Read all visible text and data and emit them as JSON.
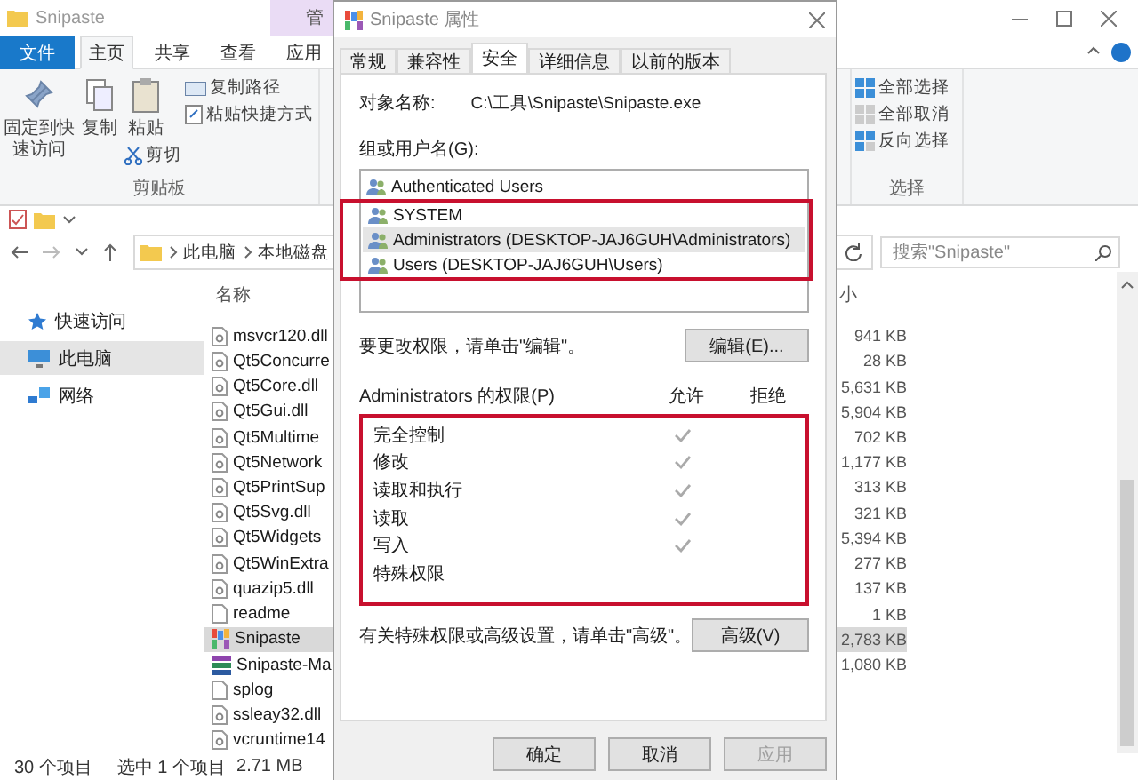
{
  "explorer": {
    "title": "Snipaste",
    "context_tab": "管",
    "ribbon_tabs": [
      {
        "label": "文件",
        "kind": "file",
        "selected": false
      },
      {
        "label": "主页",
        "kind": "tab",
        "selected": true
      },
      {
        "label": "共享",
        "kind": "tab",
        "selected": false
      },
      {
        "label": "查看",
        "kind": "tab",
        "selected": false
      },
      {
        "label": "应用",
        "kind": "tab",
        "selected": false
      }
    ],
    "clipboard": {
      "pin": "固定到快速访问",
      "copy": "复制",
      "paste": "粘贴",
      "copy_path": "复制路径",
      "paste_shortcut": "粘贴快捷方式",
      "cut": "剪切",
      "group": "剪贴板"
    },
    "select": {
      "items": [
        "全部选择",
        "全部取消",
        "反向选择"
      ],
      "group": "选择"
    },
    "address": {
      "crumbs": [
        "此电脑",
        "本地磁盘"
      ]
    },
    "search": {
      "placeholder": "搜索\"Snipaste\""
    },
    "nav": [
      {
        "label": "快速访问",
        "selected": false
      },
      {
        "label": "此电脑",
        "selected": true
      },
      {
        "label": "网络",
        "selected": false
      }
    ],
    "columns": {
      "name": "名称",
      "size": "小"
    },
    "files": [
      {
        "name": "msvcr120.dll",
        "size": "941 KB",
        "kind": "dll",
        "selected": false
      },
      {
        "name": "Qt5Concurre",
        "size": "28 KB",
        "kind": "dll",
        "selected": false
      },
      {
        "name": "Qt5Core.dll",
        "size": "5,631 KB",
        "kind": "dll",
        "selected": false
      },
      {
        "name": "Qt5Gui.dll",
        "size": "5,904 KB",
        "kind": "dll",
        "selected": false
      },
      {
        "name": "Qt5Multime",
        "size": "702 KB",
        "kind": "dll",
        "selected": false
      },
      {
        "name": "Qt5Network",
        "size": "1,177 KB",
        "kind": "dll",
        "selected": false
      },
      {
        "name": "Qt5PrintSup",
        "size": "313 KB",
        "kind": "dll",
        "selected": false
      },
      {
        "name": "Qt5Svg.dll",
        "size": "321 KB",
        "kind": "dll",
        "selected": false
      },
      {
        "name": "Qt5Widgets",
        "size": "5,394 KB",
        "kind": "dll",
        "selected": false
      },
      {
        "name": "Qt5WinExtra",
        "size": "277 KB",
        "kind": "dll",
        "selected": false
      },
      {
        "name": "quazip5.dll",
        "size": "137 KB",
        "kind": "dll",
        "selected": false
      },
      {
        "name": "readme",
        "size": "1 KB",
        "kind": "text",
        "selected": false
      },
      {
        "name": "Snipaste",
        "size": "2,783 KB",
        "kind": "app",
        "selected": true
      },
      {
        "name": "Snipaste-Ma",
        "size": "1,080 KB",
        "kind": "archive",
        "selected": false
      },
      {
        "name": "splog",
        "kind": "text",
        "selected": false
      },
      {
        "name": "ssleay32.dll",
        "kind": "dll",
        "selected": false
      },
      {
        "name": "vcruntime14",
        "kind": "dll",
        "selected": false
      }
    ],
    "status": {
      "count": "30 个项目",
      "selection": "选中 1 个项目",
      "size": "2.71 MB"
    }
  },
  "dialog": {
    "title": "Snipaste 属性",
    "tabs": [
      {
        "label": "常规",
        "selected": false
      },
      {
        "label": "兼容性",
        "selected": false
      },
      {
        "label": "安全",
        "selected": true
      },
      {
        "label": "详细信息",
        "selected": false
      },
      {
        "label": "以前的版本",
        "selected": false
      }
    ],
    "object_label": "对象名称:",
    "object_path": "C:\\工具\\Snipaste\\Snipaste.exe",
    "users_label": "组或用户名(G):",
    "users": [
      {
        "name": "Authenticated Users",
        "selected": false
      },
      {
        "name": "SYSTEM",
        "selected": false
      },
      {
        "name": "Administrators (DESKTOP-JAJ6GUH\\Administrators)",
        "selected": true
      },
      {
        "name": "Users (DESKTOP-JAJ6GUH\\Users)",
        "selected": false
      }
    ],
    "users_highlight": true,
    "edit_hint": "要更改权限，请单击\"编辑\"。",
    "edit_button": "编辑(E)...",
    "perm_label": "Administrators 的权限(P)",
    "allow_label": "允许",
    "deny_label": "拒绝",
    "permissions": [
      {
        "name": "完全控制",
        "allow": true,
        "deny": false
      },
      {
        "name": "修改",
        "allow": true,
        "deny": false
      },
      {
        "name": "读取和执行",
        "allow": true,
        "deny": false
      },
      {
        "name": "读取",
        "allow": true,
        "deny": false
      },
      {
        "name": "写入",
        "allow": true,
        "deny": false
      },
      {
        "name": "特殊权限",
        "allow": false,
        "deny": false
      }
    ],
    "perm_highlight": true,
    "advanced_hint": "有关特殊权限或高级设置，请单击\"高级\"。",
    "advanced_button": "高级(V)",
    "buttons": [
      {
        "label": "确定",
        "disabled": false
      },
      {
        "label": "取消",
        "disabled": false
      },
      {
        "label": "应用",
        "disabled": true
      }
    ]
  }
}
